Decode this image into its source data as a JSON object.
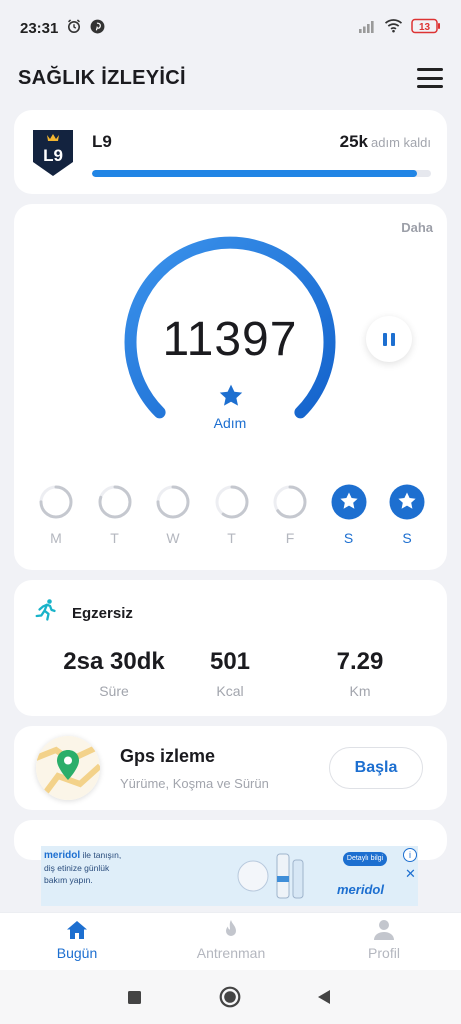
{
  "status_bar": {
    "time": "23:31",
    "battery": "13"
  },
  "header": {
    "title": "SAĞLIK İZLEYİCİ"
  },
  "level": {
    "badge_text": "L9",
    "name": "L9",
    "steps_left_value": "25k",
    "steps_left_unit": "adım kaldı",
    "progress": 0.96
  },
  "steps": {
    "more_label": "Daha",
    "count": "11397",
    "label": "Adım",
    "days": [
      {
        "label": "M",
        "done": false,
        "progress": 0.75
      },
      {
        "label": "T",
        "done": false,
        "progress": 0.8
      },
      {
        "label": "W",
        "done": false,
        "progress": 0.75
      },
      {
        "label": "T",
        "done": false,
        "progress": 0.6
      },
      {
        "label": "F",
        "done": false,
        "progress": 0.65
      },
      {
        "label": "S",
        "done": true,
        "progress": 1
      },
      {
        "label": "S",
        "done": true,
        "progress": 1
      }
    ]
  },
  "exercise": {
    "title": "Egzersiz",
    "stats": [
      {
        "value": "2sa 30dk",
        "label": "Süre"
      },
      {
        "value": "501",
        "label": "Kcal"
      },
      {
        "value": "7.29",
        "label": "Km"
      }
    ]
  },
  "gps": {
    "title": "Gps izleme",
    "subtitle": "Yürüme, Koşma ve Sürün",
    "button": "Başla"
  },
  "ad": {
    "brand": "meridol",
    "text": "ile tanışın, diş etinize günlük bakım yapın.",
    "cta": "Detaylı bilgi",
    "logo": "meridol",
    "info": "i",
    "close": "✕"
  },
  "bottom_nav": {
    "items": [
      {
        "label": "Bugün",
        "active": true
      },
      {
        "label": "Antrenman",
        "active": false
      },
      {
        "label": "Profil",
        "active": false
      }
    ]
  },
  "colors": {
    "accent": "#1d6fd0",
    "ring_start": "#2f8be8",
    "ring_end": "#1868d0",
    "inactive": "#b4b7bf",
    "card": "#ffffff",
    "background": "#f1f2f6"
  }
}
